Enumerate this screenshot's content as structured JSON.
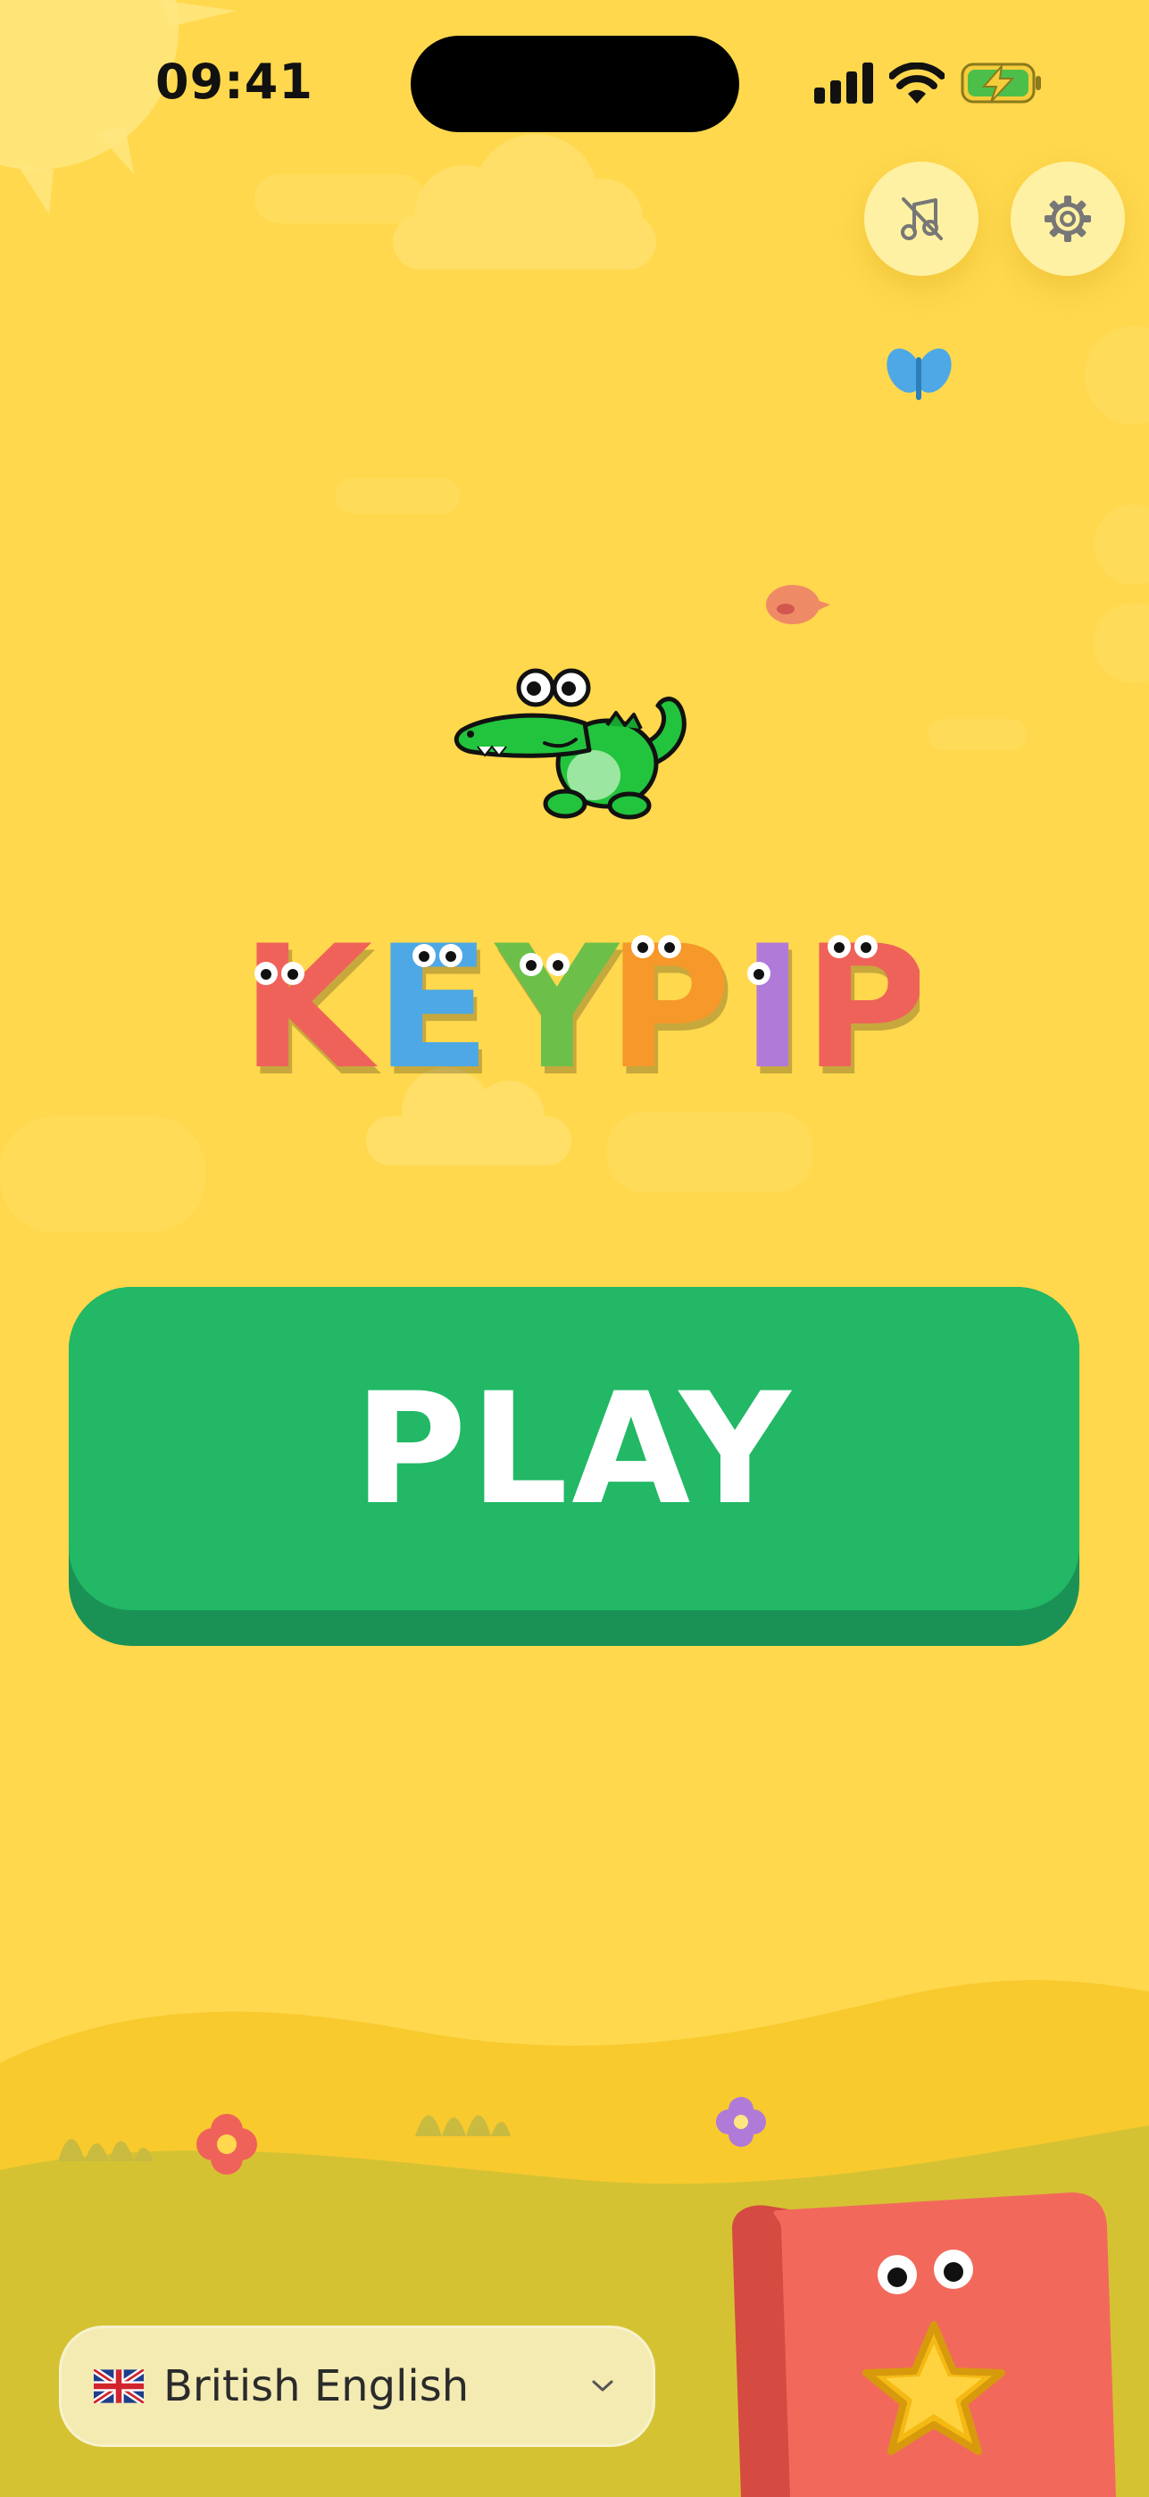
{
  "status_bar": {
    "time": "09:41",
    "icons": [
      "cellular-signal-icon",
      "wifi-icon",
      "battery-charging-icon"
    ]
  },
  "top_controls": {
    "music_toggle_icon": "music-off-icon",
    "settings_icon": "gear-icon"
  },
  "game": {
    "title_letters": [
      {
        "char": "K",
        "color": "#EF625A"
      },
      {
        "char": "E",
        "color": "#4DA8E5"
      },
      {
        "char": "Y",
        "color": "#6CC04A"
      },
      {
        "char": "P",
        "color": "#F6982A"
      },
      {
        "char": "I",
        "color": "#B07AD9"
      },
      {
        "char": "P",
        "color": "#EF625A"
      }
    ],
    "mascot": "crocodile-mascot",
    "play_label": "PLAY"
  },
  "language": {
    "flag": "🇬🇧",
    "label": "British English"
  },
  "colors": {
    "background": "#FFD84D",
    "play_button": "#22B866",
    "play_shadow": "#1B9255",
    "hill_front": "#D5C233",
    "hill_back": "#F8CA2E",
    "card": "#F2695B"
  }
}
